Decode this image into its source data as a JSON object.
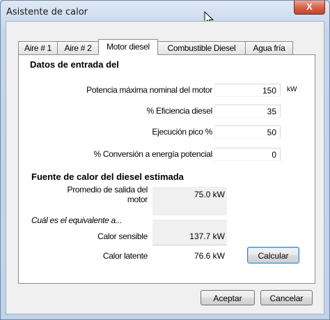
{
  "window": {
    "title": "Asistente de calor",
    "close_label": "X"
  },
  "tabs": [
    {
      "label": "Aire # 1",
      "active": false
    },
    {
      "label": "Aire # 2",
      "active": false
    },
    {
      "label": "Motor diesel",
      "active": true
    },
    {
      "label": "Combustible Diesel",
      "active": false
    },
    {
      "label": "Agua fría",
      "active": false
    }
  ],
  "inputs": {
    "heading": "Datos de entrada del",
    "power_label": "Potencia máxima nominal del motor",
    "power_value": "150",
    "power_unit": "kW",
    "efficiency_label": "% Eficiencia diesel",
    "efficiency_value": "35",
    "peak_label": "Ejecución pico %",
    "peak_value": "50",
    "conversion_label": "% Conversión a energía potencial",
    "conversion_value": "0"
  },
  "estimate": {
    "heading": "Fuente de calor del diesel estimada",
    "avg_output_label_line1": "Promedio de salida del",
    "avg_output_label_line2": "motor",
    "avg_output_value": "75.0 kW",
    "equivalent_label": "Cuál es el equivalente a...",
    "sensible_label": "Calor sensible",
    "sensible_value": "137.7 kW",
    "latent_label": "Calor latente",
    "latent_value": "76.6 kW"
  },
  "buttons": {
    "calculate": "Calcular",
    "accept": "Aceptar",
    "cancel": "Cancelar"
  }
}
